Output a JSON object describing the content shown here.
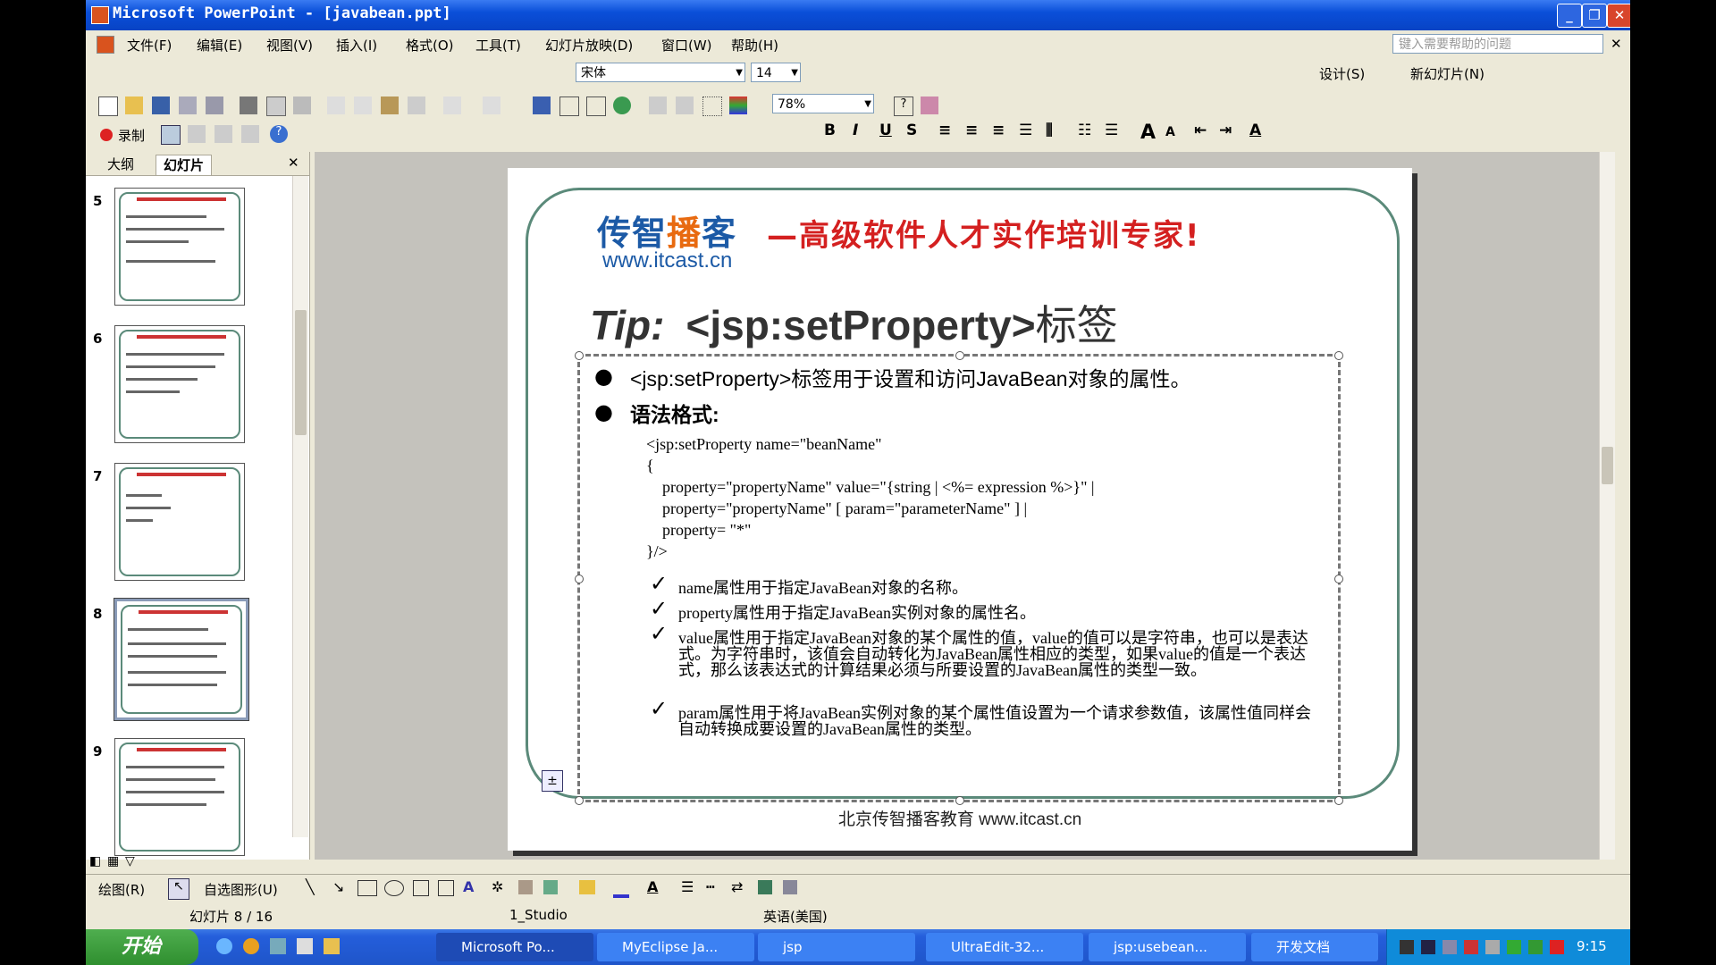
{
  "window": {
    "title": "Microsoft PowerPoint - [javabean.ppt]",
    "min": "_",
    "restore": "❐",
    "close": "✕"
  },
  "menu": {
    "items": [
      "文件(F)",
      "编辑(E)",
      "视图(V)",
      "插入(I)",
      "格式(O)",
      "工具(T)",
      "幻灯片放映(D)",
      "窗口(W)",
      "帮助(H)"
    ],
    "help_placeholder": "键入需要帮助的问题",
    "close": "✕"
  },
  "toolbar": {
    "font_name": "宋体",
    "font_size": "14",
    "zoom": "78%",
    "design_label": "设计(S)",
    "new_slide_label": "新幻灯片(N)",
    "record_label": "录制"
  },
  "left_panel": {
    "tabs": [
      "大纲",
      "幻灯片"
    ],
    "close": "✕",
    "slide_numbers": [
      "5",
      "6",
      "7",
      "8",
      "9"
    ],
    "selected_slide": "8"
  },
  "slide": {
    "logo_text_1": "传智",
    "logo_text_2": "播",
    "logo_text_3": "客",
    "logo_url": "www.itcast.cn",
    "slogan": "—高级软件人才实作培训专家!",
    "title_tip": "Tip:",
    "title_main": "<jsp:setProperty>",
    "title_cn": "标签",
    "bullet1": "<jsp:setProperty>标签用于设置和访问JavaBean对象的属性。",
    "bullet2": "语法格式:",
    "code": [
      "<jsp:setProperty name=\"beanName\"",
      "{",
      "    property=\"propertyName\" value=\"{string | <%= expression %>}\" |",
      "    property=\"propertyName\" [ param=\"parameterName\" ] |",
      "    property= \"*\"",
      "}/>"
    ],
    "notes": [
      "name属性用于指定JavaBean对象的名称。",
      "property属性用于指定JavaBean实例对象的属性名。",
      "value属性用于指定JavaBean对象的某个属性的值，value的值可以是字符串，也可以是表达式。为字符串时，该值会自动转化为JavaBean属性相应的类型，如果value的值是一个表达式，那么该表达式的计算结果必须与所要设置的JavaBean属性的类型一致。",
      "param属性用于将JavaBean实例对象的某个属性值设置为一个请求参数值，该属性值同样会自动转换成要设置的JavaBean属性的类型。"
    ],
    "check": "✓",
    "footer": "北京传智播客教育 www.itcast.cn"
  },
  "draw_toolbar": {
    "draw_label": "绘图(R)",
    "autoshape_label": "自选图形(U)"
  },
  "status": {
    "slide_info": "幻灯片 8 / 16",
    "design": "1_Studio",
    "language": "英语(美国)"
  },
  "taskbar": {
    "start": "开始",
    "tasks": [
      "Microsoft Po...",
      "MyEclipse Ja...",
      "jsp",
      "UltraEdit-32...",
      "jsp:usebean...",
      "开发文档"
    ],
    "clock": "9:15"
  }
}
